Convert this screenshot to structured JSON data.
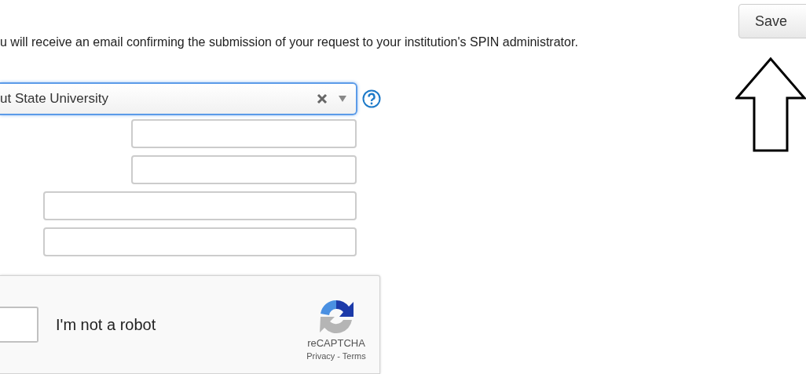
{
  "intro": "u will receive an email confirming the submission of your request to your institution's SPIN administrator.",
  "save_button": {
    "label": "Save"
  },
  "institution_select": {
    "value": "ut State University"
  },
  "fields": [
    {
      "kind": "short"
    },
    {
      "kind": "short"
    },
    {
      "kind": "long"
    },
    {
      "kind": "long"
    }
  ],
  "recaptcha": {
    "label": "I'm not a robot",
    "checked": false,
    "brand": "reCAPTCHA",
    "links": "Privacy - Terms"
  }
}
